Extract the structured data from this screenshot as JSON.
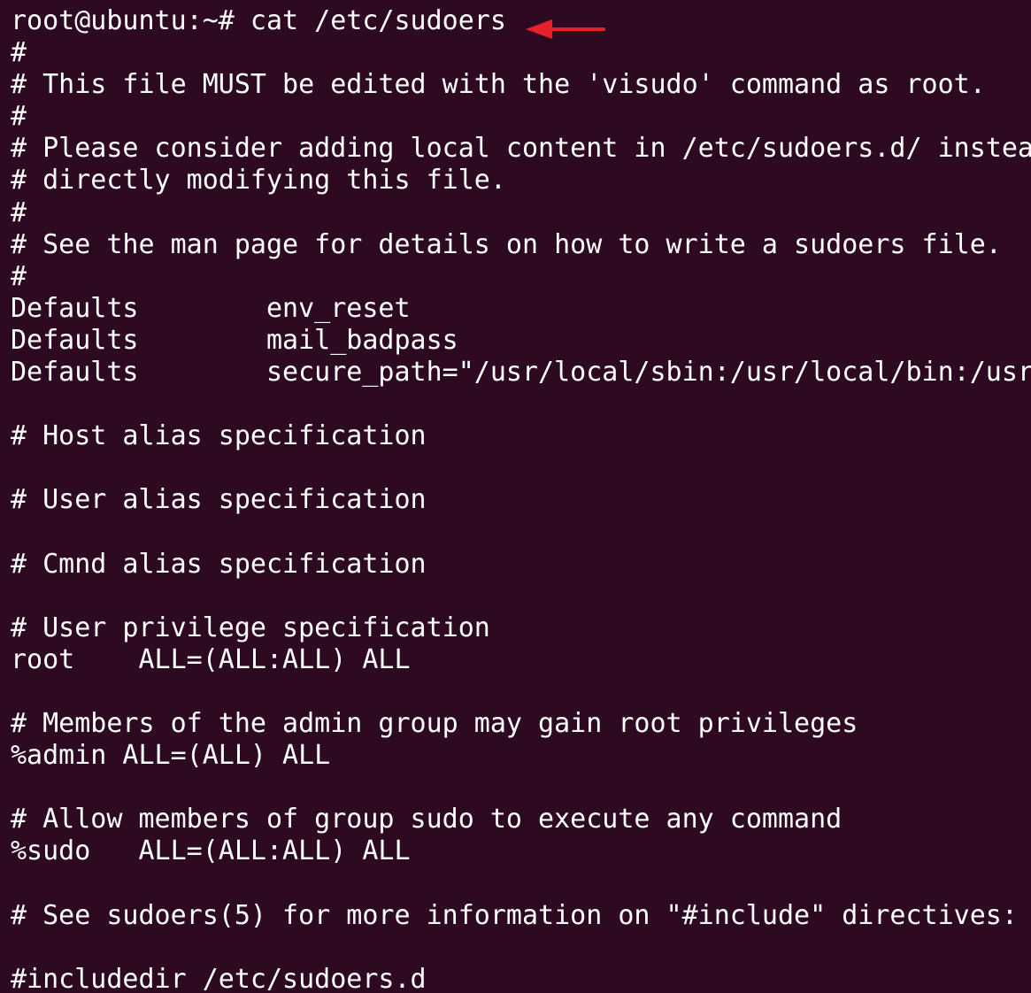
{
  "terminal": {
    "lines": [
      "root@ubuntu:~# cat /etc/sudoers",
      "#",
      "# This file MUST be edited with the 'visudo' command as root.",
      "#",
      "# Please consider adding local content in /etc/sudoers.d/ instea",
      "# directly modifying this file.",
      "#",
      "# See the man page for details on how to write a sudoers file.",
      "#",
      "Defaults        env_reset",
      "Defaults        mail_badpass",
      "Defaults        secure_path=\"/usr/local/sbin:/usr/local/bin:/usr",
      "",
      "# Host alias specification",
      "",
      "# User alias specification",
      "",
      "# Cmnd alias specification",
      "",
      "# User privilege specification",
      "root    ALL=(ALL:ALL) ALL",
      "",
      "# Members of the admin group may gain root privileges",
      "%admin ALL=(ALL) ALL",
      "",
      "# Allow members of group sudo to execute any command",
      "%sudo   ALL=(ALL:ALL) ALL",
      "",
      "# See sudoers(5) for more information on \"#include\" directives:",
      "",
      "#includedir /etc/sudoers.d"
    ],
    "arrow_icon": "arrow-left-icon",
    "colors": {
      "background": "#2d0a22",
      "text": "#ffffff",
      "arrow": "#e8202a"
    }
  }
}
